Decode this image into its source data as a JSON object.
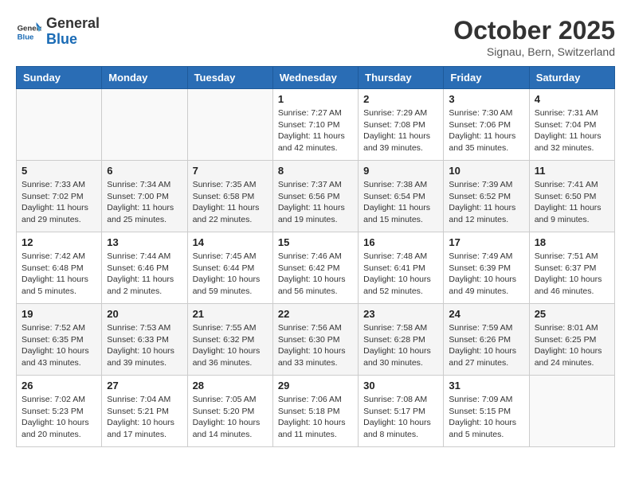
{
  "header": {
    "logo_line1": "General",
    "logo_line2": "Blue",
    "month": "October 2025",
    "location": "Signau, Bern, Switzerland"
  },
  "days_of_week": [
    "Sunday",
    "Monday",
    "Tuesday",
    "Wednesday",
    "Thursday",
    "Friday",
    "Saturday"
  ],
  "weeks": [
    [
      {
        "day": "",
        "info": ""
      },
      {
        "day": "",
        "info": ""
      },
      {
        "day": "",
        "info": ""
      },
      {
        "day": "1",
        "info": "Sunrise: 7:27 AM\nSunset: 7:10 PM\nDaylight: 11 hours and 42 minutes."
      },
      {
        "day": "2",
        "info": "Sunrise: 7:29 AM\nSunset: 7:08 PM\nDaylight: 11 hours and 39 minutes."
      },
      {
        "day": "3",
        "info": "Sunrise: 7:30 AM\nSunset: 7:06 PM\nDaylight: 11 hours and 35 minutes."
      },
      {
        "day": "4",
        "info": "Sunrise: 7:31 AM\nSunset: 7:04 PM\nDaylight: 11 hours and 32 minutes."
      }
    ],
    [
      {
        "day": "5",
        "info": "Sunrise: 7:33 AM\nSunset: 7:02 PM\nDaylight: 11 hours and 29 minutes."
      },
      {
        "day": "6",
        "info": "Sunrise: 7:34 AM\nSunset: 7:00 PM\nDaylight: 11 hours and 25 minutes."
      },
      {
        "day": "7",
        "info": "Sunrise: 7:35 AM\nSunset: 6:58 PM\nDaylight: 11 hours and 22 minutes."
      },
      {
        "day": "8",
        "info": "Sunrise: 7:37 AM\nSunset: 6:56 PM\nDaylight: 11 hours and 19 minutes."
      },
      {
        "day": "9",
        "info": "Sunrise: 7:38 AM\nSunset: 6:54 PM\nDaylight: 11 hours and 15 minutes."
      },
      {
        "day": "10",
        "info": "Sunrise: 7:39 AM\nSunset: 6:52 PM\nDaylight: 11 hours and 12 minutes."
      },
      {
        "day": "11",
        "info": "Sunrise: 7:41 AM\nSunset: 6:50 PM\nDaylight: 11 hours and 9 minutes."
      }
    ],
    [
      {
        "day": "12",
        "info": "Sunrise: 7:42 AM\nSunset: 6:48 PM\nDaylight: 11 hours and 5 minutes."
      },
      {
        "day": "13",
        "info": "Sunrise: 7:44 AM\nSunset: 6:46 PM\nDaylight: 11 hours and 2 minutes."
      },
      {
        "day": "14",
        "info": "Sunrise: 7:45 AM\nSunset: 6:44 PM\nDaylight: 10 hours and 59 minutes."
      },
      {
        "day": "15",
        "info": "Sunrise: 7:46 AM\nSunset: 6:42 PM\nDaylight: 10 hours and 56 minutes."
      },
      {
        "day": "16",
        "info": "Sunrise: 7:48 AM\nSunset: 6:41 PM\nDaylight: 10 hours and 52 minutes."
      },
      {
        "day": "17",
        "info": "Sunrise: 7:49 AM\nSunset: 6:39 PM\nDaylight: 10 hours and 49 minutes."
      },
      {
        "day": "18",
        "info": "Sunrise: 7:51 AM\nSunset: 6:37 PM\nDaylight: 10 hours and 46 minutes."
      }
    ],
    [
      {
        "day": "19",
        "info": "Sunrise: 7:52 AM\nSunset: 6:35 PM\nDaylight: 10 hours and 43 minutes."
      },
      {
        "day": "20",
        "info": "Sunrise: 7:53 AM\nSunset: 6:33 PM\nDaylight: 10 hours and 39 minutes."
      },
      {
        "day": "21",
        "info": "Sunrise: 7:55 AM\nSunset: 6:32 PM\nDaylight: 10 hours and 36 minutes."
      },
      {
        "day": "22",
        "info": "Sunrise: 7:56 AM\nSunset: 6:30 PM\nDaylight: 10 hours and 33 minutes."
      },
      {
        "day": "23",
        "info": "Sunrise: 7:58 AM\nSunset: 6:28 PM\nDaylight: 10 hours and 30 minutes."
      },
      {
        "day": "24",
        "info": "Sunrise: 7:59 AM\nSunset: 6:26 PM\nDaylight: 10 hours and 27 minutes."
      },
      {
        "day": "25",
        "info": "Sunrise: 8:01 AM\nSunset: 6:25 PM\nDaylight: 10 hours and 24 minutes."
      }
    ],
    [
      {
        "day": "26",
        "info": "Sunrise: 7:02 AM\nSunset: 5:23 PM\nDaylight: 10 hours and 20 minutes."
      },
      {
        "day": "27",
        "info": "Sunrise: 7:04 AM\nSunset: 5:21 PM\nDaylight: 10 hours and 17 minutes."
      },
      {
        "day": "28",
        "info": "Sunrise: 7:05 AM\nSunset: 5:20 PM\nDaylight: 10 hours and 14 minutes."
      },
      {
        "day": "29",
        "info": "Sunrise: 7:06 AM\nSunset: 5:18 PM\nDaylight: 10 hours and 11 minutes."
      },
      {
        "day": "30",
        "info": "Sunrise: 7:08 AM\nSunset: 5:17 PM\nDaylight: 10 hours and 8 minutes."
      },
      {
        "day": "31",
        "info": "Sunrise: 7:09 AM\nSunset: 5:15 PM\nDaylight: 10 hours and 5 minutes."
      },
      {
        "day": "",
        "info": ""
      }
    ]
  ]
}
